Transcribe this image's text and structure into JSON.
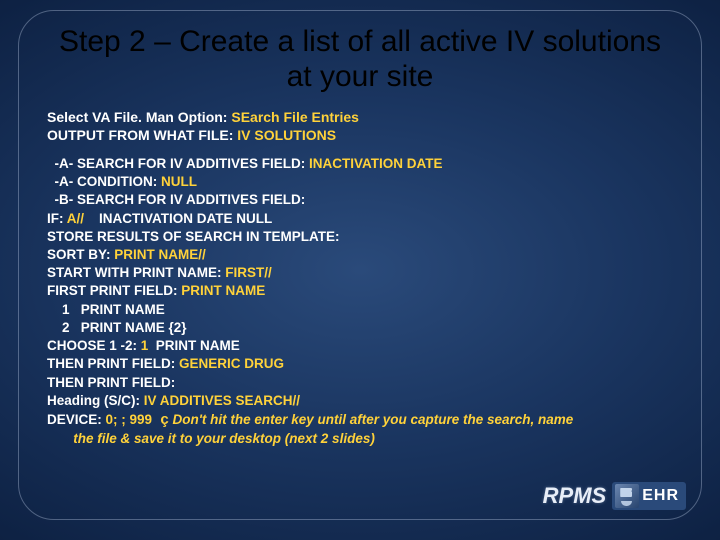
{
  "title": "Step 2 – Create a list of all active IV solutions at your site",
  "lead1_a": "Select VA File. Man Option: ",
  "lead1_b": "SEarch File Entries",
  "lead2_a": "OUTPUT FROM WHAT FILE: ",
  "lead2_b": "IV SOLUTIONS",
  "l1": "  -A- SEARCH FOR IV ADDITIVES FIELD: ",
  "l1b": "INACTIVATION DATE",
  "l2": "  -A- CONDITION: ",
  "l2b": "NULL",
  "l3": "  -B- SEARCH FOR IV ADDITIVES FIELD:",
  "l4a": "IF: ",
  "l4b": "A//",
  "l4c": "    INACTIVATION DATE NULL",
  "l5": "STORE RESULTS OF SEARCH IN TEMPLATE:",
  "l6a": "SORT BY: ",
  "l6b": "PRINT NAME//",
  "l7a": "START WITH PRINT NAME: ",
  "l7b": "FIRST//",
  "l8a": "FIRST PRINT FIELD: ",
  "l8b": "PRINT NAME",
  "l9": "    1   PRINT NAME",
  "l10": "    2   PRINT NAME {2}",
  "l11a": "CHOOSE 1 -2: ",
  "l11b": "1",
  "l11c": "  PRINT NAME",
  "l12a": "THEN PRINT FIELD: ",
  "l12b": "GENERIC DRUG",
  "l13": "THEN PRINT FIELD:",
  "l14a": "Heading (S/C): ",
  "l14b": "IV ADDITIVES SEARCH//",
  "l15a": "DEVICE: ",
  "l15b": "0; ; 999",
  "arrow": "  ç",
  "note1": " Don't hit the enter key until after you capture the search, name",
  "note2": "       the file & save it to your desktop (next 2 slides)",
  "rpms": "RPMS",
  "ehr": "EHR"
}
